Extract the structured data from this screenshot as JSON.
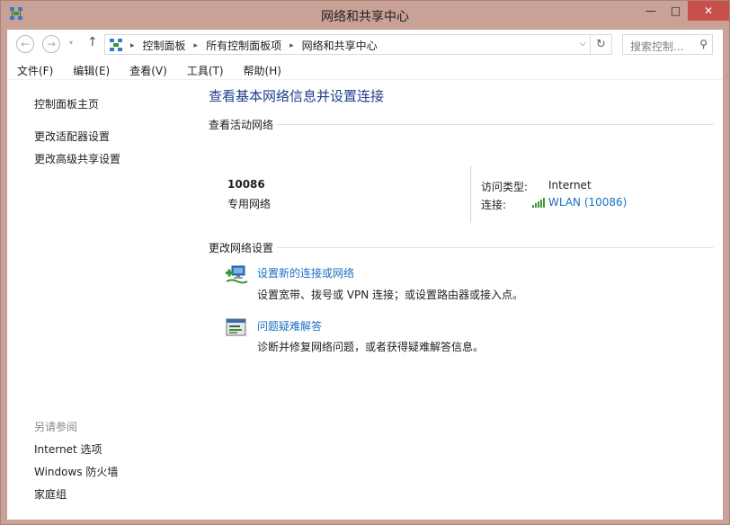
{
  "window": {
    "title": "网络和共享中心",
    "minimize_glyph": "—",
    "maximize_glyph": "□",
    "close_glyph": "✕"
  },
  "nav": {
    "back_glyph": "←",
    "forward_glyph": "→",
    "history_glyph": "▾",
    "up_glyph": "↑",
    "breadcrumbs": [
      "控制面板",
      "所有控制面板项",
      "网络和共享中心"
    ],
    "crumb_separator": "▸",
    "dropdown_glyph": "⌵",
    "refresh_glyph": "↻",
    "search_placeholder": "搜索控制...",
    "search_glyph": "⚲"
  },
  "menu": [
    "文件(F)",
    "编辑(E)",
    "查看(V)",
    "工具(T)",
    "帮助(H)"
  ],
  "sidebar": {
    "links": [
      "控制面板主页",
      "更改适配器设置",
      "更改高级共享设置"
    ],
    "see_also_header": "另请参阅",
    "see_also": [
      "Internet 选项",
      "Windows 防火墙",
      "家庭组"
    ]
  },
  "main": {
    "title": "查看基本网络信息并设置连接",
    "active_section": "查看活动网络",
    "network_name": "10086",
    "network_type": "专用网络",
    "access_label": "访问类型:",
    "access_value": "Internet",
    "connection_label": "连接:",
    "connection_value": "WLAN (10086)",
    "change_section": "更改网络设置",
    "tasks": [
      {
        "link": "设置新的连接或网络",
        "desc": "设置宽带、拨号或 VPN 连接；或设置路由器或接入点。",
        "icon": "new-connection-icon"
      },
      {
        "link": "问题疑难解答",
        "desc": "诊断并修复网络问题，或者获得疑难解答信息。",
        "icon": "troubleshoot-icon"
      }
    ]
  },
  "colors": {
    "frame": "#c9a196",
    "link": "#1b6fc2",
    "title": "#1e3f8a",
    "close": "#c7504a"
  }
}
